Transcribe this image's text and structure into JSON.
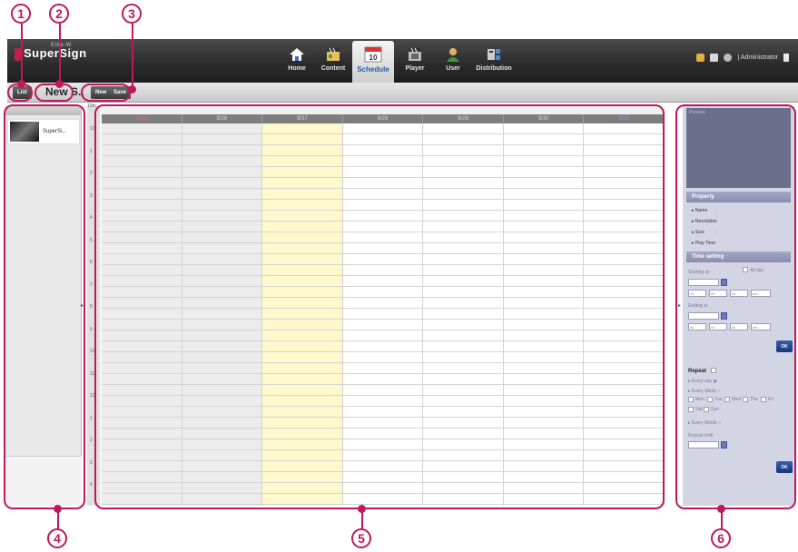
{
  "app": {
    "logo_text": "SuperSign",
    "logo_superscript": "Elite-W",
    "nav": [
      {
        "label": "Home",
        "icon": "home-icon"
      },
      {
        "label": "Content",
        "icon": "content-clapper-icon"
      },
      {
        "label": "Schedule",
        "icon": "calendar-icon"
      },
      {
        "label": "Player",
        "icon": "player-clapper-icon"
      },
      {
        "label": "User",
        "icon": "user-icon"
      },
      {
        "label": "Distribution",
        "icon": "distribution-icon"
      }
    ],
    "active_nav": "Schedule",
    "calendar_icon_day": "10",
    "user_label": "| Administrator"
  },
  "subbar": {
    "list_button": "List",
    "schedule_title": "New S..",
    "new_button": "New",
    "save_button": "Save"
  },
  "left_panel": {
    "content_item_label": "SuperSi..."
  },
  "main": {
    "zoom_label": "10m",
    "days": [
      "9/25",
      "9/26",
      "9/27",
      "9/28",
      "9/29",
      "9/30",
      "10/1"
    ],
    "today_index": 2,
    "hour_labels": [
      "12",
      "1",
      "2",
      "3",
      "4",
      "5",
      "6",
      "7",
      "8",
      "9",
      "10",
      "11",
      "12",
      "1",
      "2",
      "3",
      "4"
    ]
  },
  "right_panel": {
    "preview_label": "Preview",
    "property_title": "Property",
    "properties": [
      "Name",
      "Resolution",
      "Size",
      "Play Time"
    ],
    "time_setting_title": "Time setting",
    "starting_at": "Starting at",
    "all_day": "All day",
    "ending_at": "Ending at",
    "hour_value": "01",
    "minute_value": "00",
    "second_value": "00",
    "ampm_value": "am",
    "ok_label": "OK",
    "repeat_label": "Repeat",
    "every_day": "Every day",
    "every_week": "Every Week",
    "weekdays": [
      "Mon",
      "Tue",
      "Wed",
      "Thu",
      "Fri",
      "Sat",
      "Sun"
    ],
    "every_month": "Every Month",
    "repeat_until": "Repeat Until"
  },
  "callouts": [
    "1",
    "2",
    "3",
    "4",
    "5",
    "6"
  ],
  "colors": {
    "callout": "#c0185a",
    "today_column": "#fff8cc",
    "right_panel": "#d3d5e4"
  }
}
